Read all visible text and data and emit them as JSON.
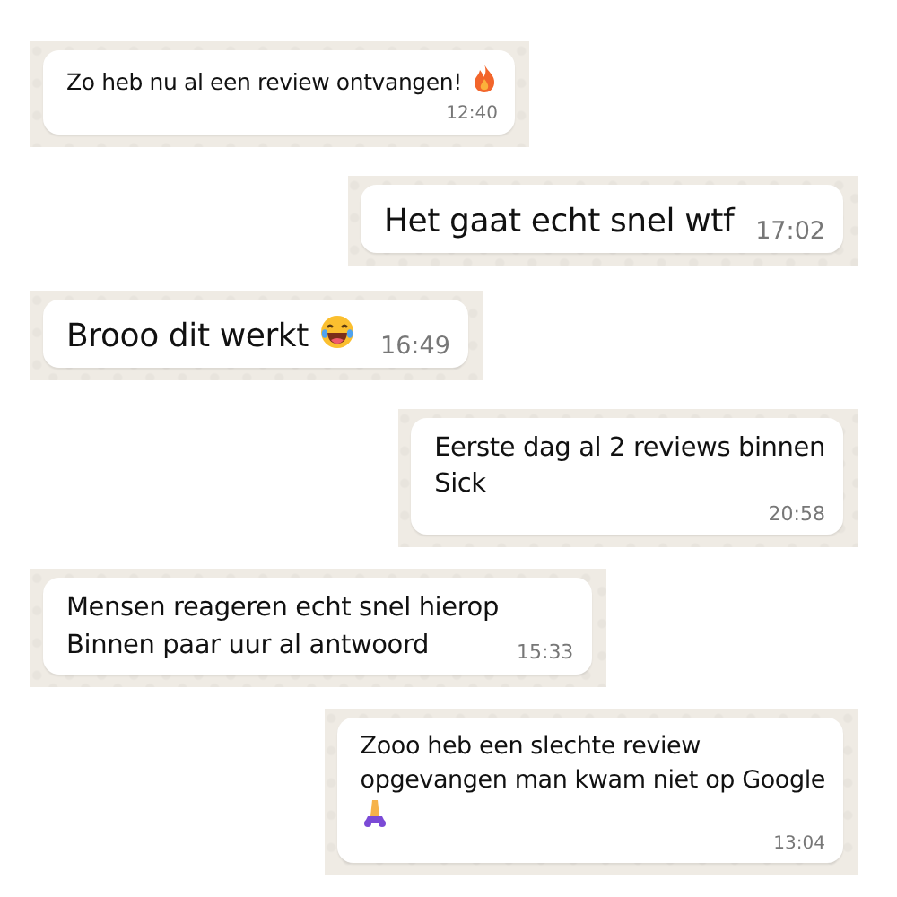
{
  "messages": [
    {
      "text": "Zo heb nu al een review ontvangen!",
      "time": "12:40"
    },
    {
      "text": "Het gaat echt snel wtf",
      "time": "17:02"
    },
    {
      "text": "Brooo dit werkt",
      "time": "16:49"
    },
    {
      "text": "Eerste dag al 2 reviews binnen\nSick",
      "time": "20:58"
    },
    {
      "text": "Mensen reageren echt snel hierop\nBinnen paar uur al antwoord",
      "time": "15:33"
    },
    {
      "text": "Zooo heb een slechte review\nopgevangen man kwam niet op Google",
      "time": "13:04"
    }
  ]
}
